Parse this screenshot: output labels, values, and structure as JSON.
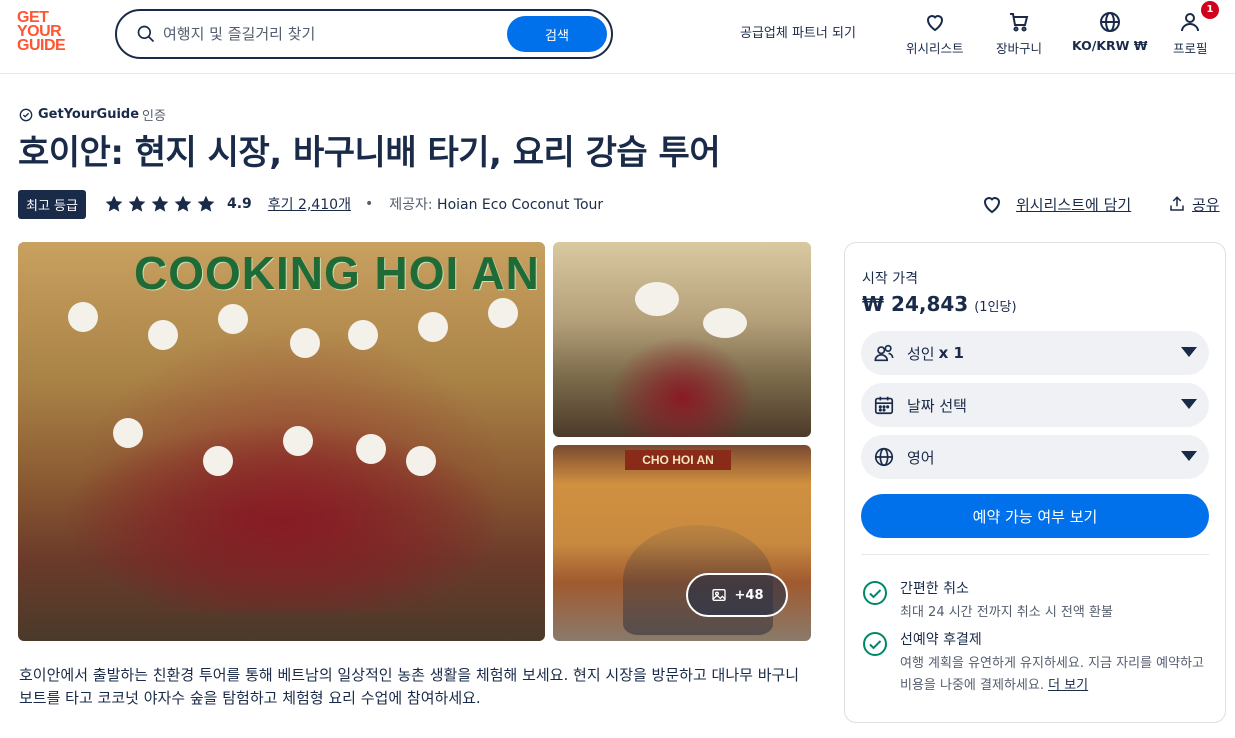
{
  "header": {
    "logo": [
      "GET",
      "YOUR",
      "GUIDE"
    ],
    "search_placeholder": "여행지 및 즐길거리 찾기",
    "search_button": "검색",
    "partner_link": "공급업체 파트너 되기",
    "nav": {
      "wishlist": "위시리스트",
      "cart": "장바구니",
      "language": "KO/KRW ₩",
      "profile": "프로필",
      "profile_badge": "1"
    }
  },
  "certified": {
    "brand": "GetYourGuide",
    "suffix": "인증"
  },
  "title": "호이안: 현지 시장, 바구니배 타기, 요리 강습 투어",
  "meta": {
    "badge": "최고 등급",
    "rating": "4.9",
    "stars": 5,
    "reviews": "후기 2,410개",
    "separator": "•",
    "provider_prefix": "제공자:",
    "provider_name": "Hoian Eco Coconut Tour",
    "wishlist_add": "위시리스트에 담기",
    "share": "공유"
  },
  "gallery": {
    "main_sign": "COOKING HOI AN",
    "bottom_sign": "CHO HOI AN",
    "more_photos": "+48"
  },
  "description": "호이안에서 출발하는 친환경 투어를 통해 베트남의 일상적인 농촌 생활을 체험해 보세요. 현지 시장을 방문하고 대나무 바구니 보트를 타고 코코넛 야자수 숲을 탐험하고 체험형 요리 수업에 참여하세요.",
  "booking": {
    "price_label": "시작 가격",
    "price": "₩ 24,843",
    "per_person": "(1인당)",
    "participants_label": "성인",
    "participants_count": "x 1",
    "date_label": "날짜 선택",
    "language_label": "영어",
    "cta": "예약 가능 여부 보기",
    "perks": [
      {
        "title": "간편한 취소",
        "desc": "최대 24 시간 전까지 취소 시 전액 환불",
        "more": ""
      },
      {
        "title": "선예약 후결제",
        "desc": "여행 계획을 유연하게 유지하세요. 지금 자리를 예약하고 비용을 나중에 결제하세요.",
        "more": "더 보기"
      }
    ]
  },
  "colors": {
    "brand": "#ff5533",
    "primary": "#0071eb",
    "text": "#1a2b49",
    "success": "#008768"
  }
}
